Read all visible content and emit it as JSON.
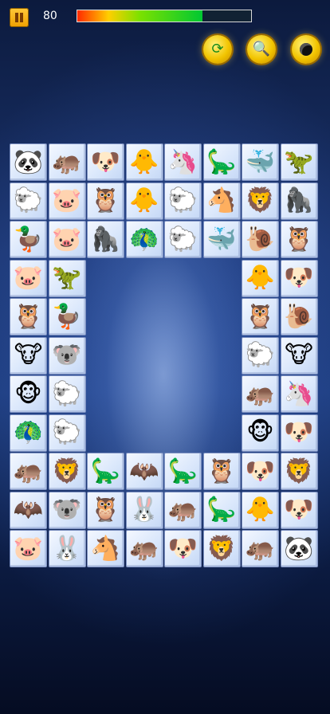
{
  "hud": {
    "score": "80",
    "time_remaining_fraction": 0.72,
    "time_bar_colors": [
      "#ff2a00",
      "#ffcf00",
      "#7be100",
      "#00c832"
    ],
    "buttons": [
      {
        "name": "pause-button",
        "icon": "pause-icon"
      },
      {
        "name": "shuffle-button",
        "icon": "shuffle-icon"
      },
      {
        "name": "hint-button",
        "icon": "magnifier-icon"
      },
      {
        "name": "bomb-button",
        "icon": "bomb-icon"
      }
    ]
  },
  "board": {
    "rows": 11,
    "cols": 8,
    "tiles": [
      [
        "panda",
        "hippo",
        "dog",
        "chick",
        "seahorse",
        "stegosaurus",
        "whale",
        "dino"
      ],
      [
        "sheep",
        "pig",
        "owl",
        "chick",
        "sheep",
        "horse",
        "lion",
        "gorilla"
      ],
      [
        "duck",
        "pig",
        "gorilla",
        "peacock",
        "sheep",
        "whale",
        "snail",
        "owl"
      ],
      [
        "pig",
        "dino",
        null,
        null,
        null,
        null,
        "chick",
        "dog"
      ],
      [
        "owl",
        "duck",
        null,
        null,
        null,
        null,
        "owl",
        "snail"
      ],
      [
        "cow",
        "koala",
        null,
        null,
        null,
        null,
        "sheep",
        "cow"
      ],
      [
        "monkey",
        "sheep",
        null,
        null,
        null,
        null,
        "hippo",
        "seahorse"
      ],
      [
        "peacock",
        "sheep",
        null,
        null,
        null,
        null,
        "monkey",
        "dog"
      ],
      [
        "hippo",
        "lion",
        "stegosaurus",
        "bat",
        "stegosaurus",
        "owl",
        "dog",
        "lion"
      ],
      [
        "bat",
        "koala",
        "owl",
        "rabbit",
        "hippo",
        "stegosaurus",
        "chick",
        "dog"
      ],
      [
        "pig",
        "rabbit",
        "horse",
        "hippo",
        "dog",
        "lion",
        "hippo",
        "panda"
      ]
    ]
  }
}
